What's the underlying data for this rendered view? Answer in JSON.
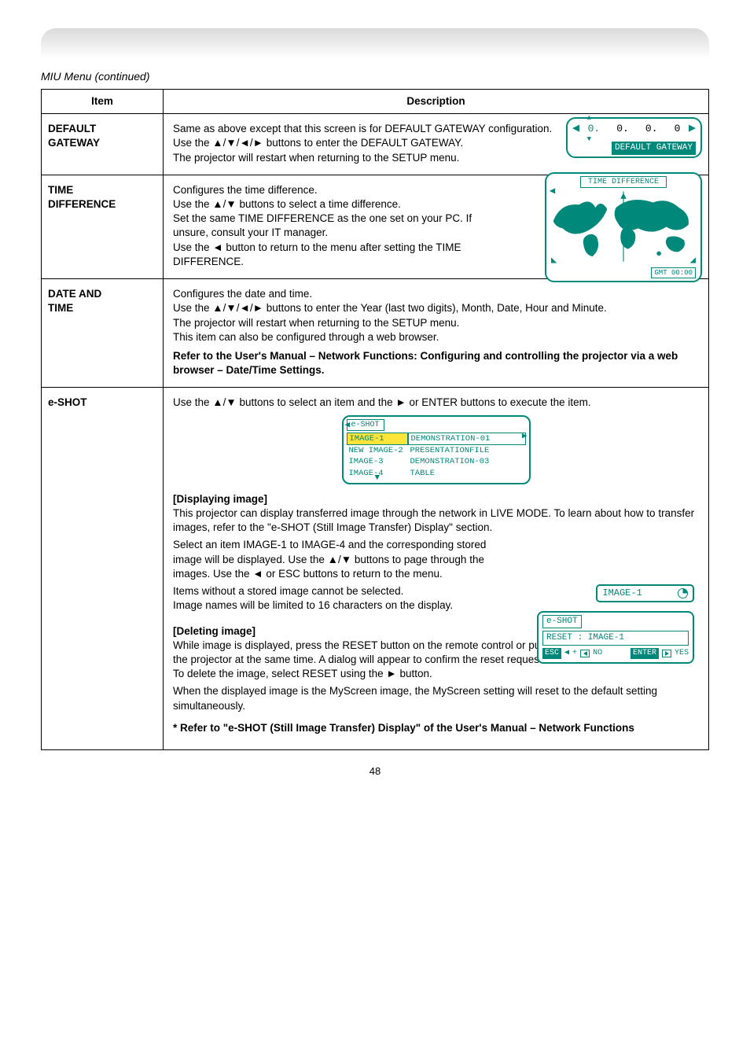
{
  "section_heading": "MIU Menu (continued)",
  "table": {
    "header": {
      "item": "Item",
      "desc": "Description"
    },
    "rows": [
      {
        "name": "DEFAULT\nGATEWAY",
        "lines": [
          "Same as above except that this screen is for DEFAULT GATEWAY configuration.",
          "Use the ▲/▼/◄/► buttons to enter the DEFAULT GATEWAY.",
          "The projector will restart when returning to the SETUP menu."
        ],
        "gateway": {
          "d1": "0.",
          "d2": "0.",
          "d3": "0.",
          "d4": "0",
          "label": "DEFAULT GATEWAY"
        }
      },
      {
        "name": "TIME\nDIFFERENCE",
        "lines": [
          "Configures the time difference.",
          "Use the ▲/▼ buttons to select a time difference.",
          "Set the same TIME DIFFERENCE as the one set on your PC. If unsure, consult your IT manager.",
          "Use the ◄ button to return to the menu after setting the TIME DIFFERENCE."
        ],
        "timemap": {
          "title": "TIME DIFFERENCE",
          "gmt": "GMT 00:00"
        }
      },
      {
        "name": "DATE AND\nTIME",
        "lines": [
          "Configures the date and time.",
          "Use the ▲/▼/◄/► buttons to enter the Year (last two digits), Month, Date, Hour and Minute.",
          "The projector will restart when returning to the SETUP menu.",
          "This item can also be configured through a web browser."
        ],
        "ref": "Refer to the User's Manual – Network Functions: Configuring and controlling the projector via a web browser – Date/Time Settings."
      },
      {
        "name": "e-SHOT",
        "intro": "Use the ▲/▼ buttons to select an item and the ► or ENTER buttons to execute the item.",
        "list_title": "e-SHOT",
        "list": [
          {
            "l": "IMAGE-1",
            "r": "DEMONSTRATION-01",
            "sel": true
          },
          {
            "l": "NEW IMAGE-2",
            "r": "PRESENTATIONFILE"
          },
          {
            "l": "IMAGE-3",
            "r": "DEMONSTRATION-03"
          },
          {
            "l": "IMAGE-4",
            "r": "TABLE"
          }
        ],
        "display_heading": "[Displaying image]",
        "display1": "This projector can display transferred image through the network in LIVE MODE. To learn about how to transfer images, refer to the \"e-SHOT (Still Image Transfer) Display\" section.",
        "display2": "Select an item IMAGE-1 to IMAGE-4 and the corresponding stored image will be displayed. Use the ▲/▼ buttons to page through the images. Use the ◄ or ESC buttons to return to the menu.",
        "display3": "Items without a stored image cannot be selected.",
        "display4": "Image names will be limited to 16 characters on the display.",
        "img_banner": "IMAGE-1",
        "delete_heading": "[Deleting image]",
        "delete1": "While image is displayed, press the RESET button on the remote control or push the ◄ and INPUT buttons on the projector at the same time. A dialog will appear to confirm the reset request.",
        "delete2": "To delete the image, select RESET using the ► button.",
        "delete3": "When the displayed image is the MyScreen image, the MyScreen setting will reset to the default setting simultaneously.",
        "reset": {
          "title": "e-SHOT",
          "sub": "RESET : IMAGE-1",
          "esc": "ESC",
          "no": "NO",
          "enter": "ENTER",
          "yes": "YES"
        },
        "note": "* Refer to \"e-SHOT (Still Image Transfer) Display\" of the User's Manual – Network Functions"
      }
    ]
  },
  "footer": "48"
}
